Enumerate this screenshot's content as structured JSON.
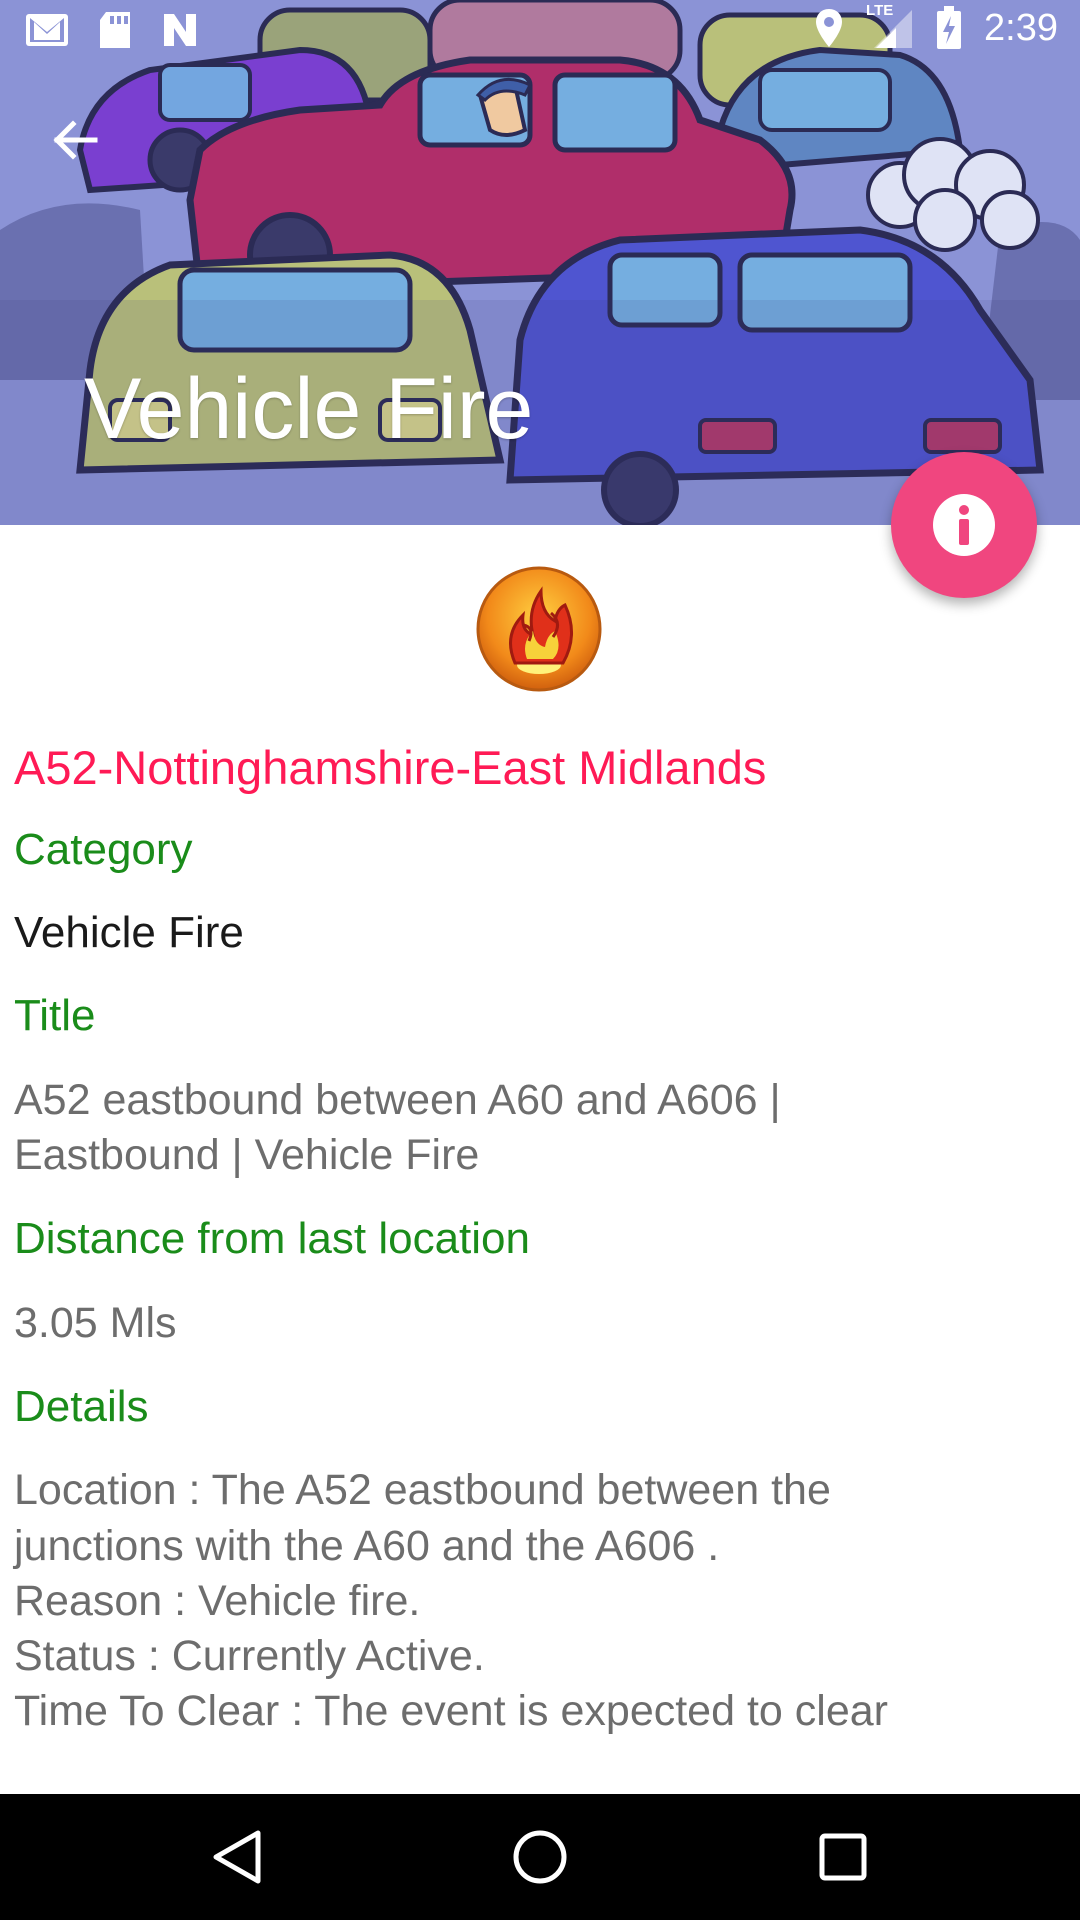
{
  "status_bar": {
    "time": "2:39",
    "left_icons": [
      "gmail-icon",
      "sd-card-icon",
      "n-icon"
    ],
    "right_icons": [
      "location-icon",
      "lte-signal-icon",
      "battery-charging-icon"
    ],
    "network_label": "LTE"
  },
  "header": {
    "title": "Vehicle Fire",
    "back_icon": "arrow-back-icon",
    "background_color": "#8b93d6"
  },
  "fab": {
    "icon": "info-icon",
    "color": "#f0467f"
  },
  "event": {
    "category_icon": "fire-icon",
    "road": "A52-Nottinghamshire-East Midlands",
    "category_label": "Category",
    "category_value": "Vehicle Fire",
    "title_label": "Title",
    "title_value": "A52 eastbound between A60 and A606 |\nEastbound | Vehicle Fire",
    "distance_label": "Distance from last location",
    "distance_value": "3.05  Mls",
    "details_label": "Details",
    "details_value": "Location : The A52 eastbound between the\njunctions with the A60  and the A606 .\nReason : Vehicle fire.\nStatus : Currently Active.\nTime To Clear : The event is expected to clear"
  },
  "colors": {
    "road_title": "#ff1a55",
    "labels": "#1a8c1a",
    "values": "#6d6d6d"
  },
  "nav_bar": {
    "icons": [
      "back-triangle-icon",
      "home-circle-icon",
      "recents-square-icon"
    ]
  }
}
